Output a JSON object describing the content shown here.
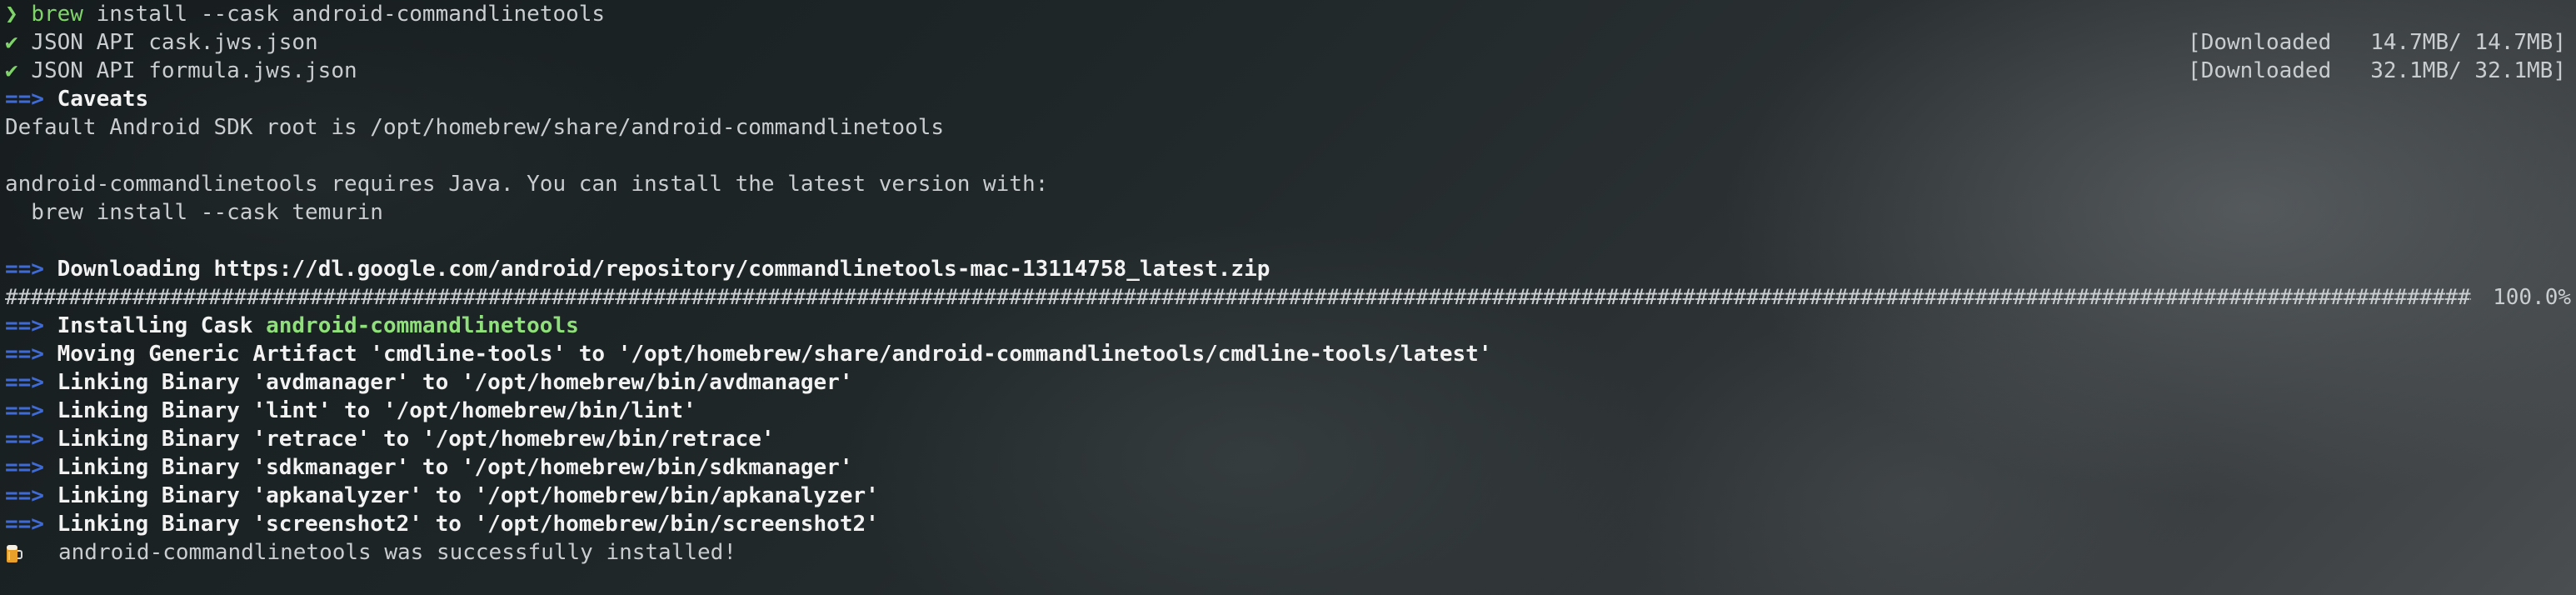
{
  "prompt": {
    "symbol": "❯",
    "command": "brew",
    "args": " install --cask android-commandlinetools"
  },
  "fetch": [
    {
      "check": "✔",
      "name": "JSON API cask.jws.json",
      "status": "[Downloaded   14.7MB/ 14.7MB]"
    },
    {
      "check": "✔",
      "name": "JSON API formula.jws.json",
      "status": "[Downloaded   32.1MB/ 32.1MB]"
    }
  ],
  "arrow": "==>",
  "caveats": {
    "title": "Caveats",
    "line1": "Default Android SDK root is /opt/homebrew/share/android-commandlinetools",
    "line2": "android-commandlinetools requires Java. You can install the latest version with:",
    "line3": "  brew install --cask temurin"
  },
  "download": {
    "text": "Downloading https://dl.google.com/android/repository/commandlinetools-mac-13114758_latest.zip",
    "bar": "########################################################################################################################################################################################################################",
    "percent": "100.0%"
  },
  "installing": {
    "prefix": "Installing Cask ",
    "name": "android-commandlinetools"
  },
  "steps": [
    "Moving Generic Artifact 'cmdline-tools' to '/opt/homebrew/share/android-commandlinetools/cmdline-tools/latest'",
    "Linking Binary 'avdmanager' to '/opt/homebrew/bin/avdmanager'",
    "Linking Binary 'lint' to '/opt/homebrew/bin/lint'",
    "Linking Binary 'retrace' to '/opt/homebrew/bin/retrace'",
    "Linking Binary 'sdkmanager' to '/opt/homebrew/bin/sdkmanager'",
    "Linking Binary 'apkanalyzer' to '/opt/homebrew/bin/apkanalyzer'",
    "Linking Binary 'screenshot2' to '/opt/homebrew/bin/screenshot2'"
  ],
  "success": {
    "icon": "beer-mug-icon",
    "text": "android-commandlinetools was successfully installed!"
  }
}
